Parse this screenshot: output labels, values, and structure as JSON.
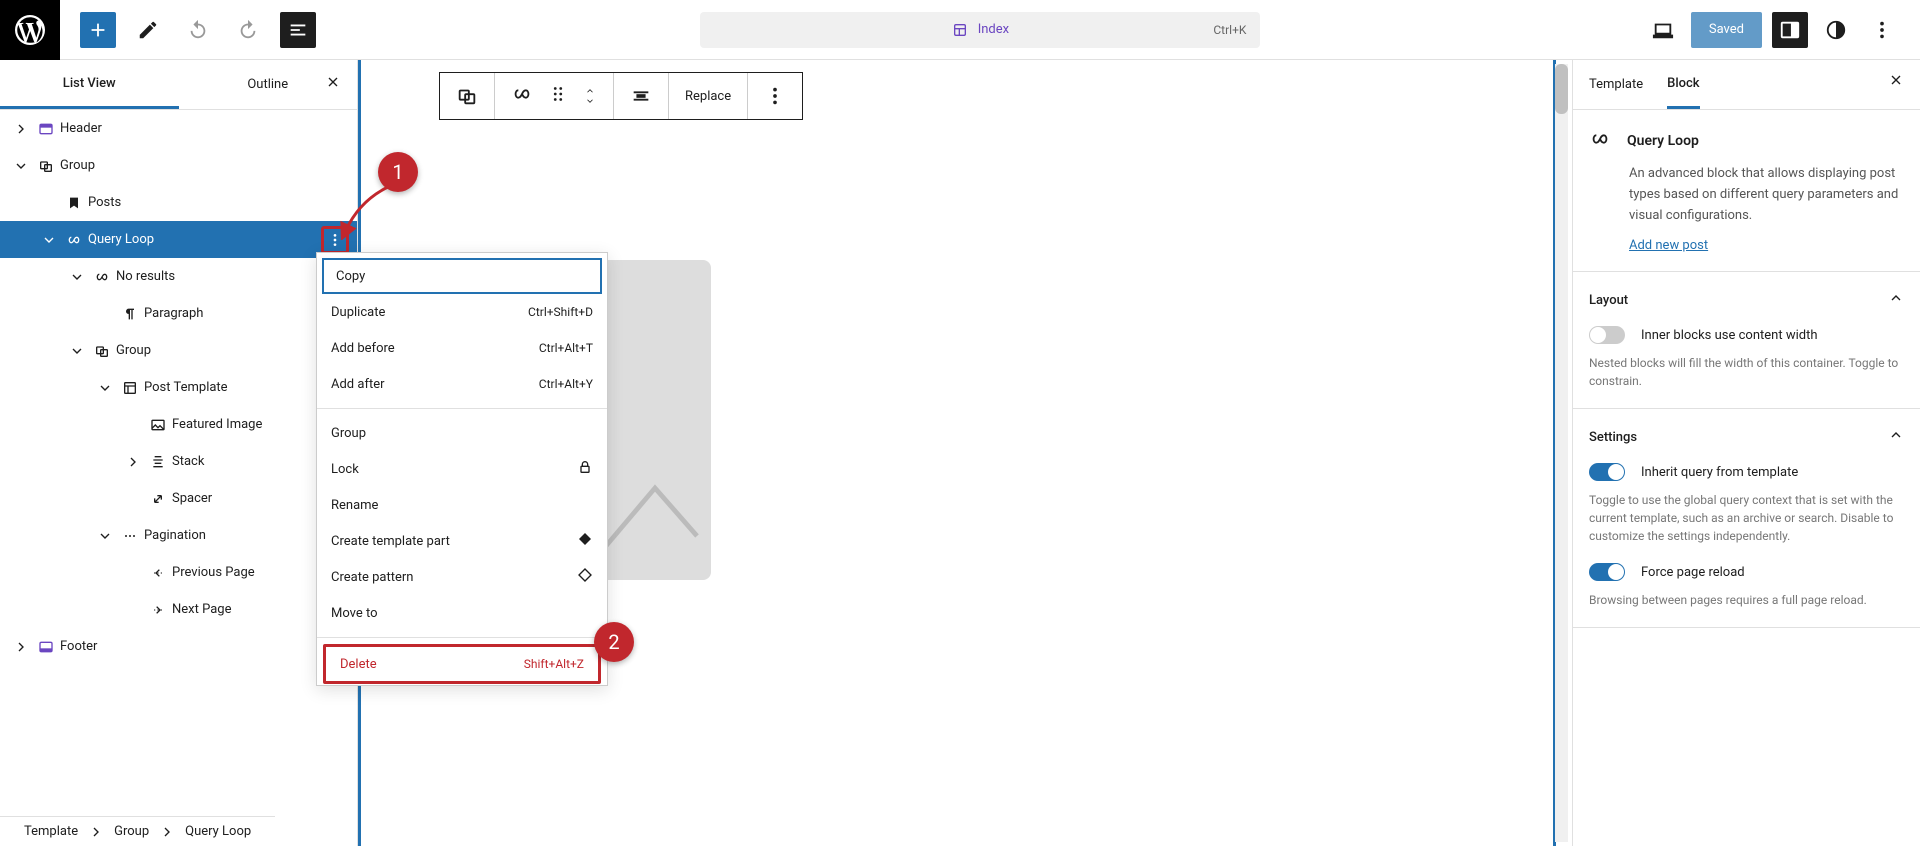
{
  "topbar": {
    "doc_title": "Index",
    "doc_shortcut": "Ctrl+K",
    "saved": "Saved"
  },
  "panel_left": {
    "tabs": [
      "List View",
      "Outline"
    ],
    "active_tab": 0,
    "tree": [
      {
        "indent": 0,
        "chev": "right",
        "icon": "header",
        "label": "Header",
        "selected": false
      },
      {
        "indent": 0,
        "chev": "down",
        "icon": "group",
        "label": "Group"
      },
      {
        "indent": 1,
        "chev": "",
        "icon": "bookmark",
        "label": "Posts"
      },
      {
        "indent": 1,
        "chev": "down",
        "icon": "loop",
        "label": "Query Loop",
        "selected": true,
        "opts": true
      },
      {
        "indent": 2,
        "chev": "down",
        "icon": "loop",
        "label": "No results"
      },
      {
        "indent": 3,
        "chev": "",
        "icon": "paragraph",
        "label": "Paragraph"
      },
      {
        "indent": 2,
        "chev": "down",
        "icon": "group",
        "label": "Group"
      },
      {
        "indent": 3,
        "chev": "down",
        "icon": "template",
        "label": "Post Template"
      },
      {
        "indent": 4,
        "chev": "",
        "icon": "image",
        "label": "Featured Image"
      },
      {
        "indent": 4,
        "chev": "right",
        "icon": "stack",
        "label": "Stack"
      },
      {
        "indent": 4,
        "chev": "",
        "icon": "spacer",
        "label": "Spacer"
      },
      {
        "indent": 3,
        "chev": "down",
        "icon": "pagination",
        "label": "Pagination"
      },
      {
        "indent": 4,
        "chev": "",
        "icon": "prev",
        "label": "Previous Page"
      },
      {
        "indent": 4,
        "chev": "",
        "icon": "next",
        "label": "Next Page"
      },
      {
        "indent": 0,
        "chev": "right",
        "icon": "footer",
        "label": "Footer"
      }
    ]
  },
  "block_toolbar": {
    "replace": "Replace"
  },
  "context_menu": {
    "items": [
      {
        "label": "Copy",
        "focused": true
      },
      {
        "label": "Duplicate",
        "shortcut": "Ctrl+Shift+D"
      },
      {
        "label": "Add before",
        "shortcut": "Ctrl+Alt+T"
      },
      {
        "label": "Add after",
        "shortcut": "Ctrl+Alt+Y"
      },
      {
        "sep": true
      },
      {
        "label": "Group"
      },
      {
        "label": "Lock",
        "icon": "lock"
      },
      {
        "label": "Rename"
      },
      {
        "label": "Create template part",
        "icon": "diamond-fill"
      },
      {
        "label": "Create pattern",
        "icon": "diamond"
      },
      {
        "label": "Move to"
      },
      {
        "sep": true
      },
      {
        "label": "Delete",
        "shortcut": "Shift+Alt+Z",
        "del": true
      }
    ]
  },
  "panel_right": {
    "tabs": [
      "Template",
      "Block"
    ],
    "active_tab": 1,
    "block": {
      "title": "Query Loop",
      "desc": "An advanced block that allows displaying post types based on different query parameters and visual configurations.",
      "link": "Add new post"
    },
    "layout": {
      "title": "Layout",
      "toggle": false,
      "toggle_label": "Inner blocks use content width",
      "help": "Nested blocks will fill the width of this container. Toggle to constrain."
    },
    "settings": {
      "title": "Settings",
      "inherit": {
        "on": true,
        "label": "Inherit query from template",
        "help": "Toggle to use the global query context that is set with the current template, such as an archive or search. Disable to customize the settings independently."
      },
      "force": {
        "on": true,
        "label": "Force page reload",
        "help": "Browsing between pages requires a full page reload."
      }
    }
  },
  "breadcrumb": [
    "Template",
    "Group",
    "Query Loop"
  ],
  "callouts": {
    "c1": "1",
    "c2": "2"
  }
}
